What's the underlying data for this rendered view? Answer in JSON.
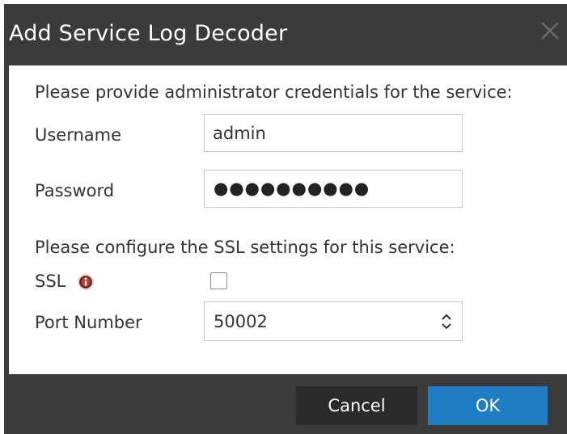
{
  "dialog": {
    "title": "Add Service Log Decoder",
    "close_icon": "close-icon"
  },
  "credentials": {
    "prompt": "Please provide administrator credentials for the service:",
    "username_label": "Username",
    "username_value": "admin",
    "password_label": "Password",
    "password_masked": "●●●●●●●●●●"
  },
  "ssl": {
    "prompt": "Please configure the SSL settings for this service:",
    "ssl_label": "SSL",
    "info_icon": "info-icon",
    "ssl_checked": false,
    "port_label": "Port Number",
    "port_value": "50002"
  },
  "buttons": {
    "cancel": "Cancel",
    "ok": "OK"
  },
  "colors": {
    "chrome": "#3b3b3b",
    "primary_button": "#1f7ec3",
    "secondary_button": "#2a2a2a",
    "info_icon": "#c0392b"
  }
}
